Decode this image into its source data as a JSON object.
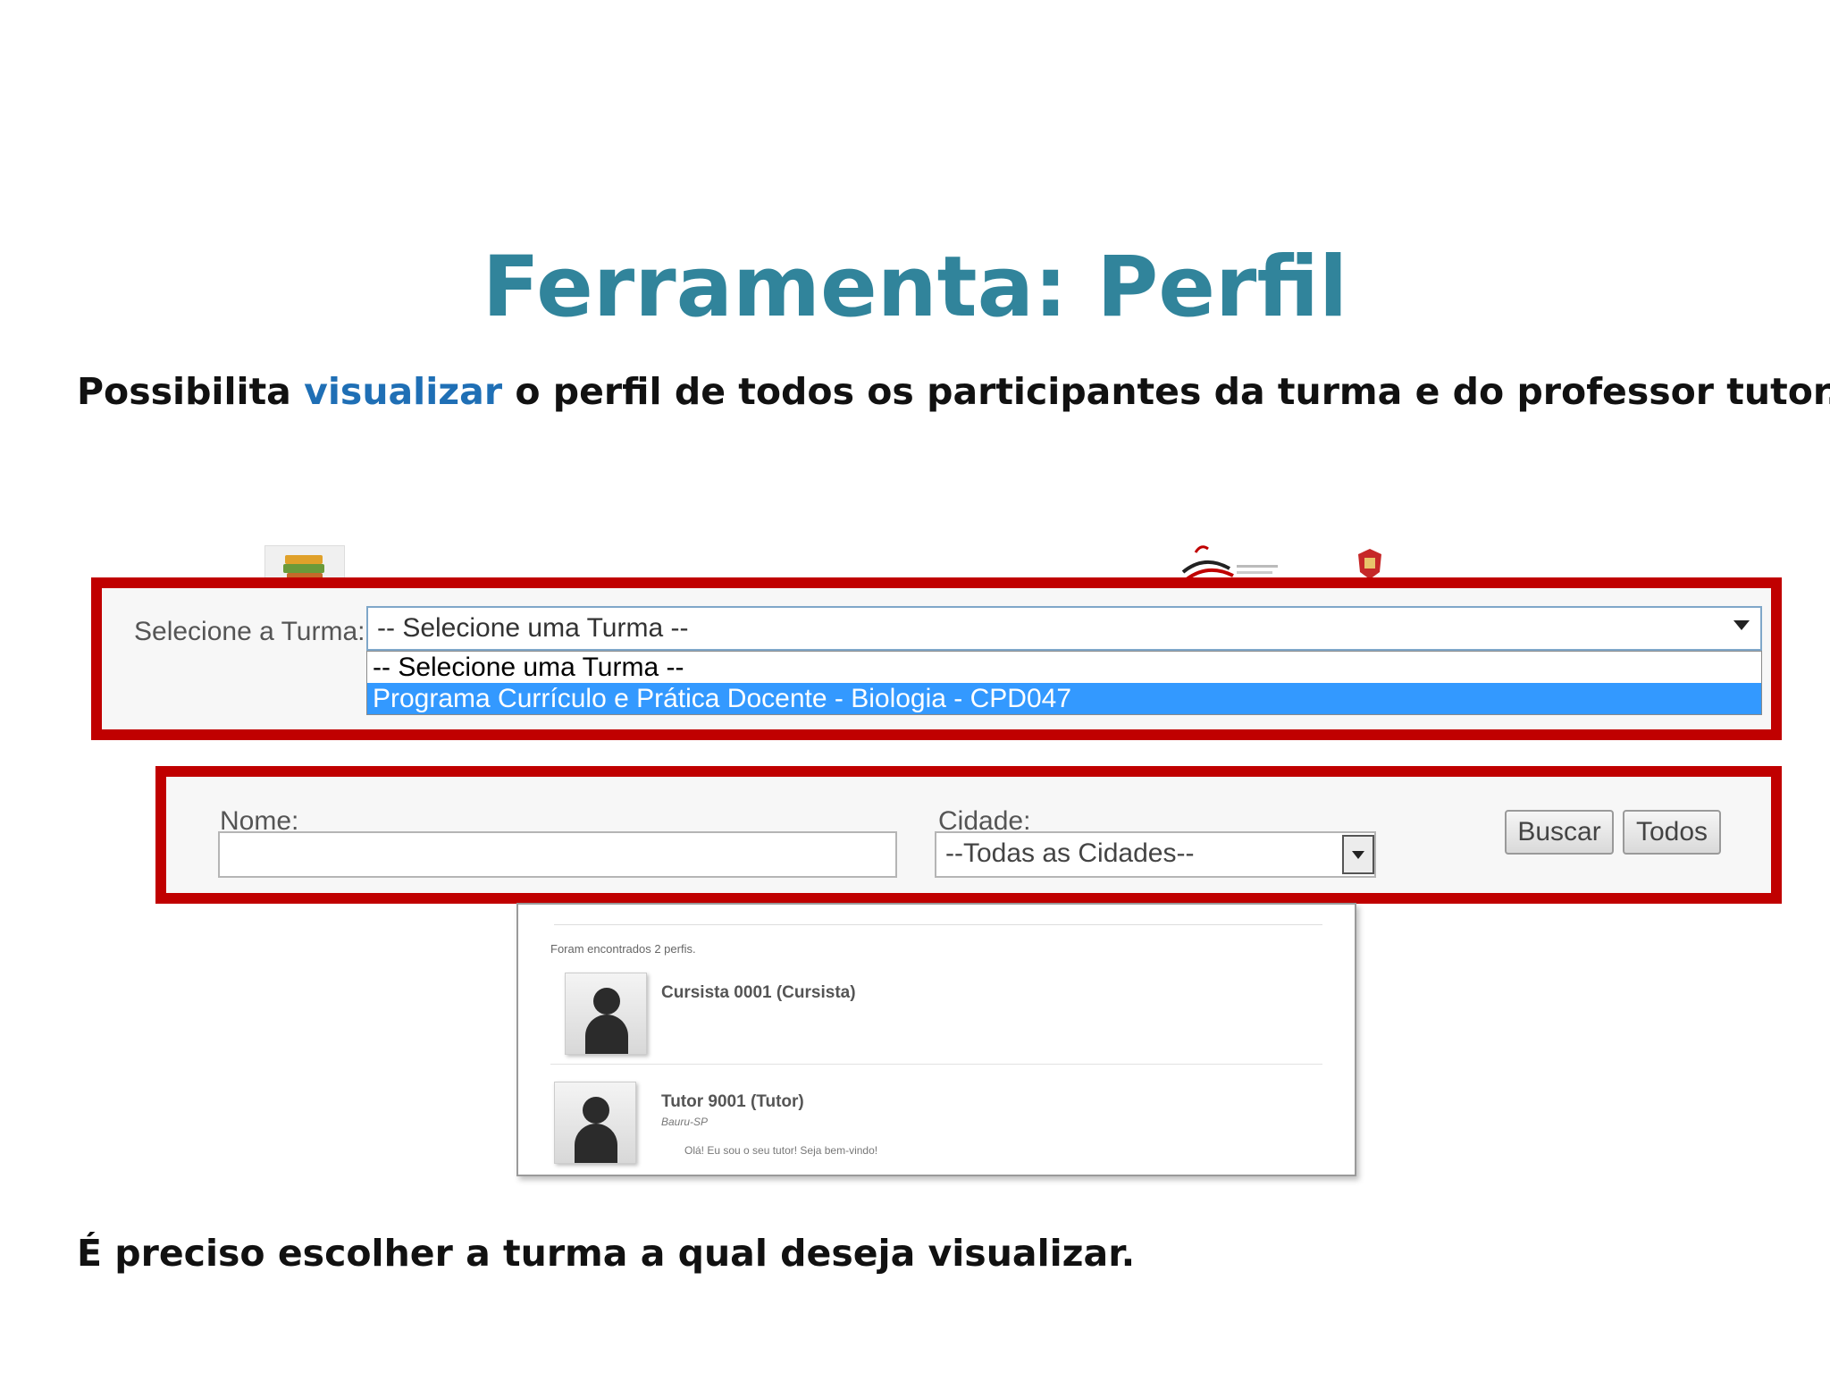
{
  "slide": {
    "title": "Ferramenta: Perfil",
    "intro_before": "Possibilita ",
    "intro_highlight": "visualizar",
    "intro_after": " o perfil de todos os participantes da turma e do professor tutor.",
    "bottom_note": "É preciso escolher a turma a qual deseja visualizar."
  },
  "turma": {
    "label": "Selecione a Turma:",
    "selected": "-- Selecione uma Turma --",
    "options": [
      "-- Selecione uma Turma --",
      "Programa Currículo e Prática Docente - Biologia - CPD047"
    ],
    "highlighted_index": 1
  },
  "filters": {
    "nome_label": "Nome:",
    "nome_value": "",
    "cidade_label": "Cidade:",
    "cidade_selected": "--Todas as Cidades--",
    "buscar_label": "Buscar",
    "todos_label": "Todos"
  },
  "results": {
    "found_text": "Foram encontrados 2 perfis.",
    "profiles": [
      {
        "name": "Cursista 0001 (Cursista)",
        "city": "",
        "message": ""
      },
      {
        "name": "Tutor 9001 (Tutor)",
        "city": "Bauru-SP",
        "message": "Olá! Eu sou o seu tutor! Seja bem-vindo!"
      }
    ]
  },
  "colors": {
    "title": "#31849b",
    "highlight": "#1f6fb5",
    "frame": "#c00000",
    "selection": "#3399ff"
  },
  "icons": [
    "books-icon",
    "secretaria-logo-icon",
    "state-crest-icon",
    "chevron-down-icon",
    "avatar-icon"
  ]
}
